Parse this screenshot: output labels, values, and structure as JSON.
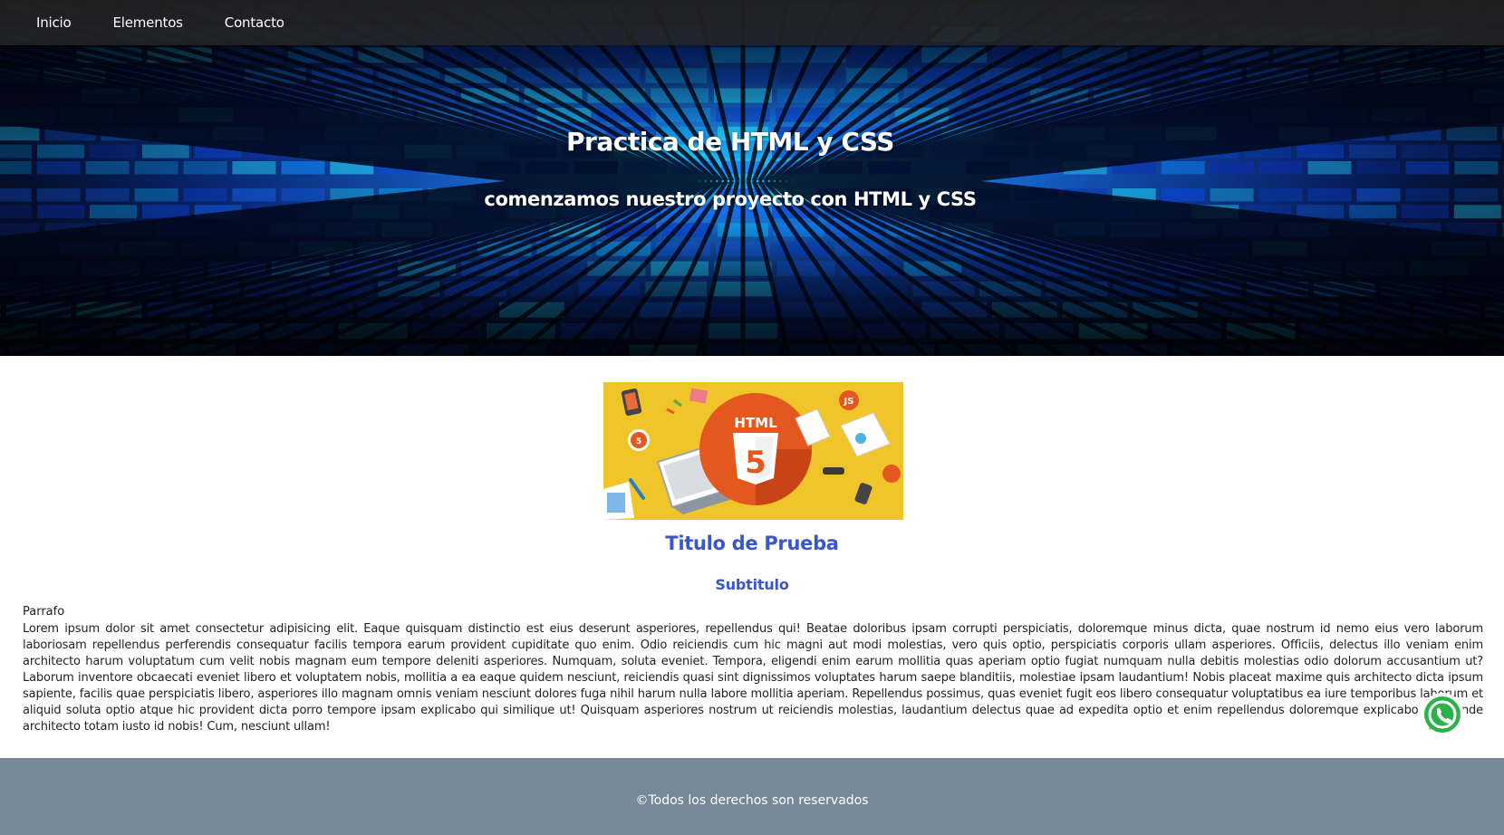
{
  "nav": {
    "items": [
      {
        "label": "Inicio"
      },
      {
        "label": "Elementos"
      },
      {
        "label": "Contacto"
      }
    ]
  },
  "hero": {
    "title": "Practica de HTML y CSS",
    "subtitle": "comenzamos nuestro proyecto con HTML y CSS"
  },
  "figure": {
    "badge": "HTML",
    "shield_number": "5",
    "js_label": "JS"
  },
  "content": {
    "title": "Titulo de Prueba",
    "subtitle": "Subtitulo",
    "paragraph_label": "Parrafo",
    "paragraph": "Lorem ipsum dolor sit amet consectetur adipisicing elit. Eaque quisquam distinctio est eius deserunt asperiores, repellendus qui! Beatae doloribus ipsam corrupti perspiciatis, doloremque minus dicta, quae nostrum id nemo eius vero laborum laboriosam repellendus perferendis consequatur facilis tempora earum provident cupiditate quo enim. Odio reiciendis cum hic magni aut modi molestias, vero quis optio, perspiciatis corporis ullam asperiores. Officiis, delectus illo veniam enim architecto harum voluptatum cum velit nobis magnam eum tempore deleniti asperiores. Numquam, soluta eveniet. Tempora, eligendi enim earum mollitia quas aperiam optio fugiat numquam nulla debitis molestias odio dolorum accusantium ut? Laborum inventore obcaecati eveniet libero et voluptatem nobis, mollitia a ea eaque quidem nesciunt, reiciendis quasi sint dignissimos voluptates harum saepe blanditiis, molestiae ipsam laudantium! Nobis placeat maxime quis architecto dicta ipsum sapiente, facilis quae perspiciatis libero, asperiores illo magnam omnis veniam nesciunt dolores fuga nihil harum nulla labore mollitia aperiam. Repellendus possimus, quas eveniet fugit eos libero consequatur voluptatibus ea iure temporibus laborum et aliquid soluta optio atque hic provident dicta porro tempore ipsam explicabo qui similique ut! Quisquam asperiores nostrum ut reiciendis molestias, laudantium delectus quae ad expedita optio et enim repellendus doloremque explicabo esse unde architecto totam iusto id nobis! Cum, nesciunt ullam!"
  },
  "footer": {
    "text": "©Todos los derechos son reservados"
  },
  "floating": {
    "icon": "whatsapp-icon"
  },
  "colors": {
    "accent_blue": "#3b56c8",
    "footer_bg": "#778899",
    "figure_bg": "#f0c52a",
    "html5_orange": "#e4571f"
  }
}
